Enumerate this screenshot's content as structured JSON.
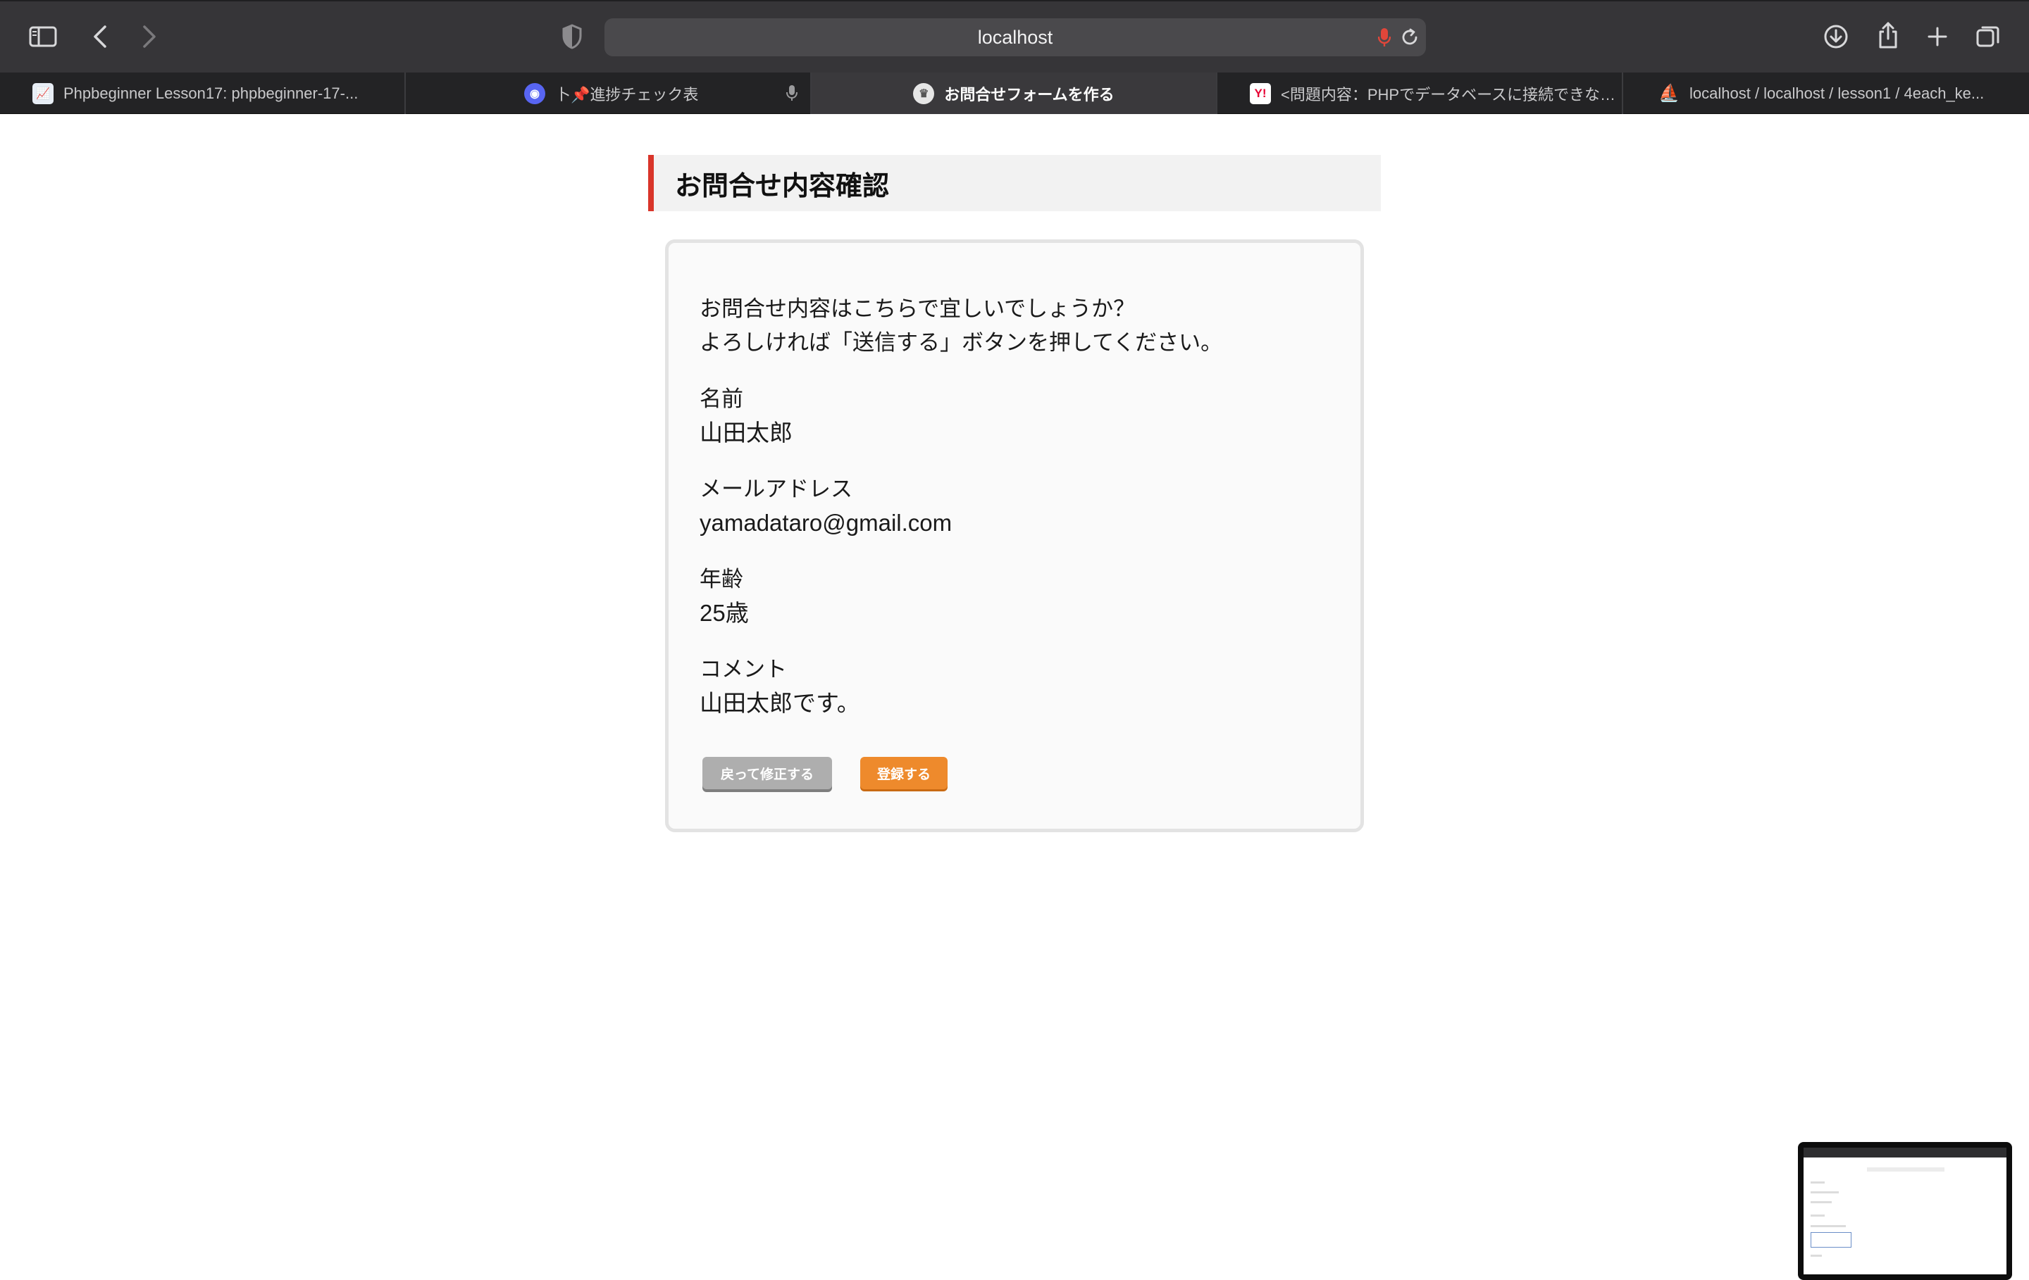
{
  "browser": {
    "url": "localhost",
    "tabs": [
      {
        "title": "Phpbeginner Lesson17: phpbeginner-17-...",
        "active": false,
        "favicon": "chart-favicon"
      },
      {
        "title": "卜📌進捗チェック表",
        "active": false,
        "favicon": "discord-favicon"
      },
      {
        "title": "お問合せフォームを作る",
        "active": true,
        "favicon": "site-favicon"
      },
      {
        "title": "<問題内容：PHPでデータベースに接続できな…",
        "active": false,
        "favicon": "yahoo-favicon"
      },
      {
        "title": "localhost / localhost / lesson1 / 4each_ke...",
        "active": false,
        "favicon": "phpmyadmin-favicon"
      }
    ],
    "colors": {
      "toolbar": "#363538",
      "tabbar": "#232325",
      "active_tab": "#3a393c",
      "mic_red": "#e0463a"
    }
  },
  "page": {
    "heading": "お問合せ内容確認",
    "lead_line1": "お問合せ内容はこちらで宜しいでしょうか？",
    "lead_line2": "よろしければ「送信する」ボタンを押してください。",
    "fields": [
      {
        "label": "名前",
        "value": "山田太郎"
      },
      {
        "label": "メールアドレス",
        "value": "yamadataro@gmail.com"
      },
      {
        "label": "年齢",
        "value": "25歳"
      },
      {
        "label": "コメント",
        "value": "山田太郎です。"
      }
    ],
    "buttons": {
      "back_label": "戻って修正する",
      "submit_label": "登録する"
    },
    "colors": {
      "heading_accent": "#d9352a",
      "submit_button": "#ee8a2c",
      "back_button": "#aeaeae"
    }
  }
}
